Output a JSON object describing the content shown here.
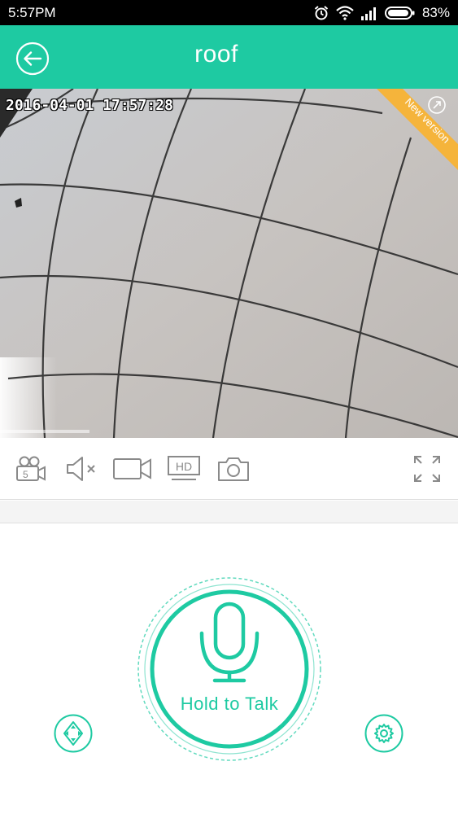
{
  "status_bar": {
    "time": "5:57PM",
    "battery": "83%",
    "icons": [
      "alarm-icon",
      "wifi-icon",
      "signal-icon",
      "battery-icon"
    ]
  },
  "header": {
    "title": "roof",
    "back_icon": "back-arrow-icon"
  },
  "video": {
    "timestamp": "2016-04-01 17:57:28",
    "ribbon_label": "New version"
  },
  "toolbar": {
    "items": [
      "record-icon",
      "mute-icon",
      "video-record-icon",
      "hd-icon",
      "snapshot-icon",
      "fullscreen-icon"
    ],
    "hd_label": "HD"
  },
  "talk": {
    "label": "Hold to Talk"
  },
  "controls": {
    "ptz_icon": "ptz-direction-icon",
    "settings_icon": "gear-icon"
  },
  "colors": {
    "accent": "#1ecaa2",
    "status_bar": "#000000",
    "ribbon": "#f5b43b",
    "icon_gray": "#8a8a8a"
  }
}
